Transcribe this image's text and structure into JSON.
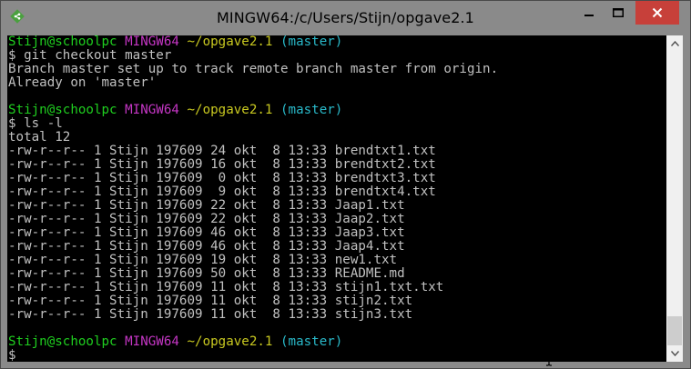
{
  "window": {
    "title": "MINGW64:/c/Users/Stijn/opgave2.1",
    "icons": {
      "app": "git-bash-icon",
      "minimize": "minimize-icon",
      "maximize": "maximize-icon",
      "close": "close-icon"
    },
    "colors": {
      "title_bg": "#8a8a8a",
      "close_bg": "#c7403a",
      "term_bg": "#000000",
      "text": "#c0c0c0",
      "user_host": "#1fce1f",
      "mingw": "#c436c4",
      "path": "#c8c820",
      "branch": "#29b8c8"
    }
  },
  "terminal": {
    "lines": [
      [
        {
          "t": "Stijn@schoolpc",
          "c": "green"
        },
        {
          "t": " ",
          "c": "white"
        },
        {
          "t": "MINGW64",
          "c": "magenta"
        },
        {
          "t": " ",
          "c": "white"
        },
        {
          "t": "~/opgave2.1",
          "c": "yellow"
        },
        {
          "t": " ",
          "c": "white"
        },
        {
          "t": "(master)",
          "c": "cyan"
        }
      ],
      [
        {
          "t": "$ git checkout master",
          "c": "white"
        }
      ],
      [
        {
          "t": "Branch master set up to track remote branch master from origin.",
          "c": "white"
        }
      ],
      [
        {
          "t": "Already on 'master'",
          "c": "white"
        }
      ],
      [
        {
          "t": "",
          "c": "white"
        }
      ],
      [
        {
          "t": "Stijn@schoolpc",
          "c": "green"
        },
        {
          "t": " ",
          "c": "white"
        },
        {
          "t": "MINGW64",
          "c": "magenta"
        },
        {
          "t": " ",
          "c": "white"
        },
        {
          "t": "~/opgave2.1",
          "c": "yellow"
        },
        {
          "t": " ",
          "c": "white"
        },
        {
          "t": "(master)",
          "c": "cyan"
        }
      ],
      [
        {
          "t": "$ ls -l",
          "c": "white"
        }
      ],
      [
        {
          "t": "total 12",
          "c": "white"
        }
      ],
      [
        {
          "t": "-rw-r--r-- 1 Stijn 197609 24 okt  8 13:33 brendtxt1.txt",
          "c": "white"
        }
      ],
      [
        {
          "t": "-rw-r--r-- 1 Stijn 197609 16 okt  8 13:33 brendtxt2.txt",
          "c": "white"
        }
      ],
      [
        {
          "t": "-rw-r--r-- 1 Stijn 197609  0 okt  8 13:33 brendtxt3.txt",
          "c": "white"
        }
      ],
      [
        {
          "t": "-rw-r--r-- 1 Stijn 197609  9 okt  8 13:33 brendtxt4.txt",
          "c": "white"
        }
      ],
      [
        {
          "t": "-rw-r--r-- 1 Stijn 197609 22 okt  8 13:33 Jaap1.txt",
          "c": "white"
        }
      ],
      [
        {
          "t": "-rw-r--r-- 1 Stijn 197609 22 okt  8 13:33 Jaap2.txt",
          "c": "white"
        }
      ],
      [
        {
          "t": "-rw-r--r-- 1 Stijn 197609 46 okt  8 13:33 Jaap3.txt",
          "c": "white"
        }
      ],
      [
        {
          "t": "-rw-r--r-- 1 Stijn 197609 46 okt  8 13:33 Jaap4.txt",
          "c": "white"
        }
      ],
      [
        {
          "t": "-rw-r--r-- 1 Stijn 197609 19 okt  8 13:33 new1.txt",
          "c": "white"
        }
      ],
      [
        {
          "t": "-rw-r--r-- 1 Stijn 197609 50 okt  8 13:33 README.md",
          "c": "white"
        }
      ],
      [
        {
          "t": "-rw-r--r-- 1 Stijn 197609 11 okt  8 13:33 stijn1.txt.txt",
          "c": "white"
        }
      ],
      [
        {
          "t": "-rw-r--r-- 1 Stijn 197609 11 okt  8 13:33 stijn2.txt",
          "c": "white"
        }
      ],
      [
        {
          "t": "-rw-r--r-- 1 Stijn 197609 11 okt  8 13:33 stijn3.txt",
          "c": "white"
        }
      ],
      [
        {
          "t": "",
          "c": "white"
        }
      ],
      [
        {
          "t": "Stijn@schoolpc",
          "c": "green"
        },
        {
          "t": " ",
          "c": "white"
        },
        {
          "t": "MINGW64",
          "c": "magenta"
        },
        {
          "t": " ",
          "c": "white"
        },
        {
          "t": "~/opgave2.1",
          "c": "yellow"
        },
        {
          "t": " ",
          "c": "white"
        },
        {
          "t": "(master)",
          "c": "cyan"
        }
      ],
      [
        {
          "t": "$",
          "c": "white"
        }
      ]
    ]
  },
  "scrollbar": {
    "position": 0.96,
    "icons": {
      "up": "scroll-up-icon",
      "down": "scroll-down-icon"
    }
  },
  "cursor": {
    "icon": "text-cursor-icon"
  }
}
